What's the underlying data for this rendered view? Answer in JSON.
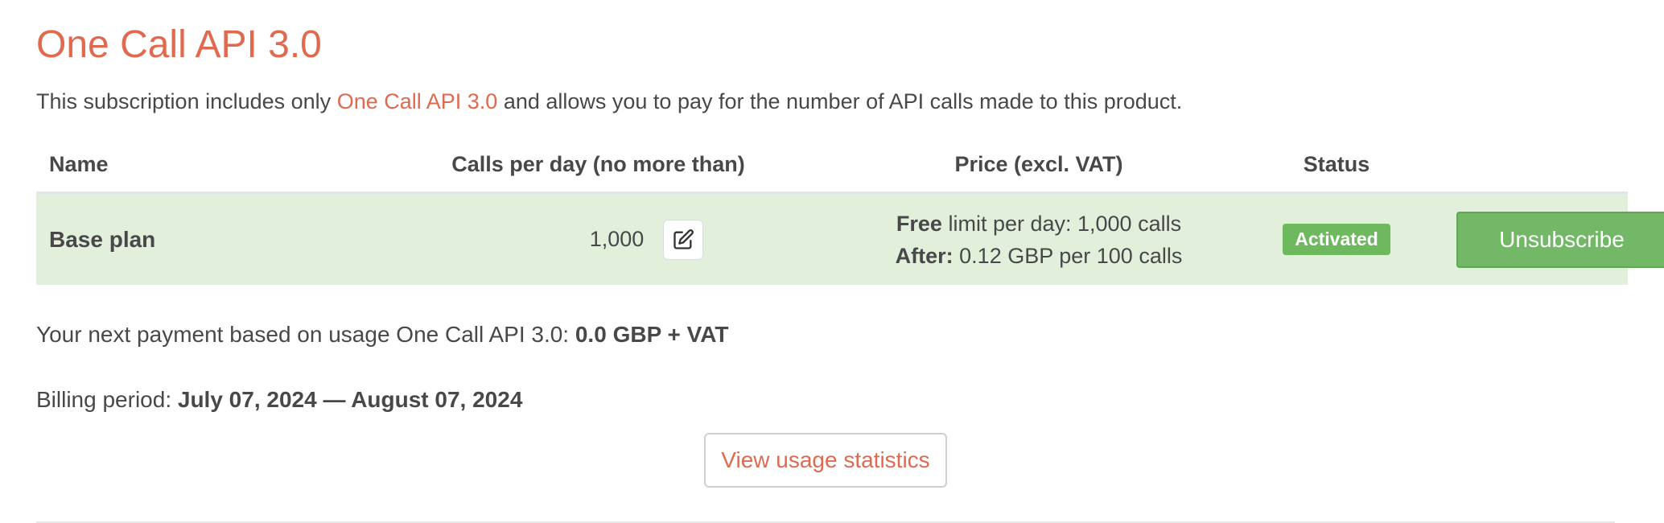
{
  "page": {
    "title": "One Call API 3.0"
  },
  "intro": {
    "prefix": "This subscription includes only ",
    "link_text": "One Call API 3.0",
    "suffix": " and allows you to pay for the number of API calls made to this product."
  },
  "table": {
    "headers": {
      "name": "Name",
      "calls": "Calls per day (no more than)",
      "price": "Price (excl. VAT)",
      "status": "Status"
    },
    "rows": [
      {
        "name": "Base plan",
        "calls": "1,000",
        "price_line1_bold": "Free",
        "price_line1_rest": " limit per day: 1,000 calls",
        "price_line2_bold": "After:",
        "price_line2_rest": " 0.12 GBP per 100 calls",
        "status": "Activated",
        "action_label": "Unsubscribe"
      }
    ]
  },
  "payment": {
    "label": "Your next payment based on usage One Call API 3.0: ",
    "amount": "0.0 GBP + VAT"
  },
  "billing": {
    "label": "Billing period: ",
    "period": "July 07, 2024 — August 07, 2024"
  },
  "buttons": {
    "view_usage": "View usage statistics"
  },
  "colors": {
    "accent": "#e06a4f",
    "row_background": "#e1efdb",
    "success": "#6eb85e",
    "text": "#48484a"
  },
  "icons": {
    "edit": "edit-icon"
  }
}
